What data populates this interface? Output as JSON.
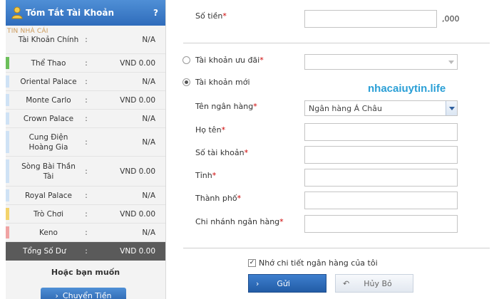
{
  "sidebar": {
    "title": "Tóm Tắt Tài Khoản",
    "help": "?",
    "watermark": "TIN NHÀ CÁI",
    "rows": [
      {
        "label": "Tài Khoản Chính",
        "value": "N/A",
        "color": ""
      },
      {
        "label": "Thể Thao",
        "value": "VND 0.00",
        "color": "#6cbf5a"
      },
      {
        "label": "Oriental Palace",
        "value": "N/A",
        "color": "#cfe2f5"
      },
      {
        "label": "Monte Carlo",
        "value": "VND 0.00",
        "color": "#cfe2f5"
      },
      {
        "label": "Crown Palace",
        "value": "N/A",
        "color": "#cfe2f5"
      },
      {
        "label": "Cung Điện Hoàng Gia",
        "value": "N/A",
        "color": "#cfe2f5"
      },
      {
        "label": "Sòng Bài Thần Tài",
        "value": "VND 0.00",
        "color": "#cfe2f5"
      },
      {
        "label": "Royal Palace",
        "value": "N/A",
        "color": "#cfe2f5"
      },
      {
        "label": "Trò Chơi",
        "value": "VND 0.00",
        "color": "#f3d36b"
      },
      {
        "label": "Keno",
        "value": "N/A",
        "color": "#f0a3a3"
      }
    ],
    "total": {
      "label": "Tổng Số Dư",
      "value": "VND 0.00"
    },
    "footer": "Hoặc bạn muốn",
    "transfer_button": "Chuyển Tiền"
  },
  "form": {
    "amount_label": "Số tiền",
    "amount_suffix": ",000",
    "promo_account_label": "Tài khoản ưu đãi",
    "new_account_label": "Tài khoản mới",
    "bank_name_label": "Tên ngân hàng",
    "bank_name_value": "Ngân hàng Á Châu",
    "full_name_label": "Họ tên",
    "account_number_label": "Số tài khoản",
    "province_label": "Tỉnh",
    "city_label": "Thành phố",
    "branch_label": "Chi nhánh ngân hàng",
    "required_mark": "*",
    "remember_label": "Nhớ chi tiết ngân hàng của tôi",
    "submit_button": "Gửi",
    "cancel_button": "Hủy Bỏ"
  },
  "watermark_right": "nhacaiuytin.life",
  "colors": {
    "accent": "#2f6cbb",
    "required": "#cc0000",
    "watermark": "#2a9fd6"
  }
}
